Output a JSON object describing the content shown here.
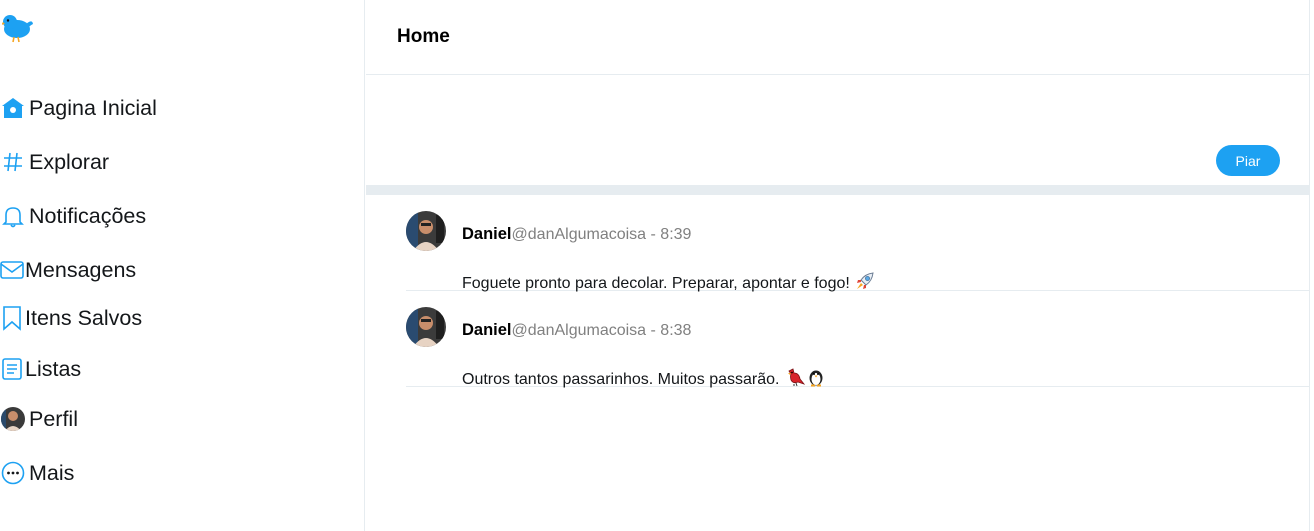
{
  "sidebar": {
    "logo_icon": "bird-logo-icon",
    "items": [
      {
        "label": "Pagina Inicial",
        "icon": "home-icon"
      },
      {
        "label": "Explorar",
        "icon": "hashtag-icon"
      },
      {
        "label": "Notificações",
        "icon": "bell-icon"
      },
      {
        "label": "Mensagens",
        "icon": "envelope-icon"
      },
      {
        "label": "Itens Salvos",
        "icon": "bookmark-icon"
      },
      {
        "label": "Listas",
        "icon": "list-icon"
      },
      {
        "label": "Perfil",
        "icon": "avatar-icon"
      },
      {
        "label": "Mais",
        "icon": "more-icon"
      }
    ]
  },
  "header": {
    "title": "Home"
  },
  "composer": {
    "value": "",
    "button_label": "Piar"
  },
  "tweets": [
    {
      "name": "Daniel",
      "handle": "@danAlgumacoisa",
      "separator": " - ",
      "time": "8:39",
      "text": "Foguete pronto para decolar. Preparar, apontar e fogo!",
      "emojis": [
        "rocket-emoji"
      ]
    },
    {
      "name": "Daniel",
      "handle": "@danAlgumacoisa",
      "separator": " - ",
      "time": "8:38",
      "text": "Outros tantos passarinhos. Muitos passarão.",
      "emojis": [
        "red-bird-emoji",
        "penguin-emoji"
      ]
    }
  ],
  "colors": {
    "accent": "#1da1f2",
    "border": "#e6ecf0",
    "muted_text": "#808080"
  }
}
